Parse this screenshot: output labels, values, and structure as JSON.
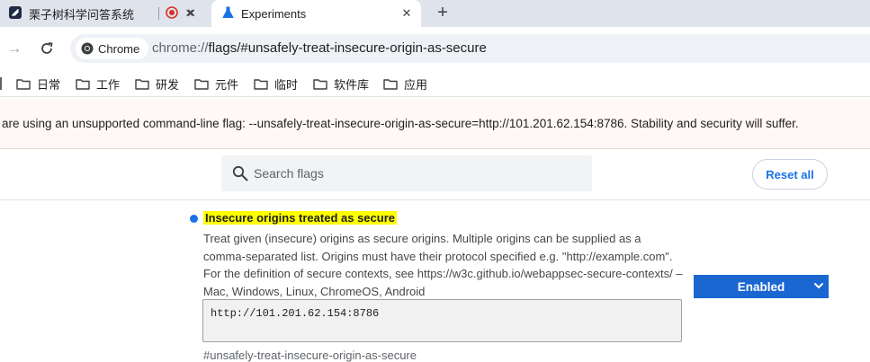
{
  "tabs": [
    {
      "title": "栗子树科学问答系统",
      "icon": "app-logo-icon",
      "active": false
    },
    {
      "title": "",
      "icon": "recording-icon",
      "active": false
    },
    {
      "title": "Experiments",
      "icon": "flask-icon",
      "active": true
    }
  ],
  "toolbar": {
    "chip_label": "Chrome",
    "url_scheme": "chrome://",
    "url_rest": "flags/#unsafely-treat-insecure-origin-as-secure"
  },
  "bookmarks": [
    "日常",
    "工作",
    "研发",
    "元件",
    "临时",
    "软件库",
    "应用"
  ],
  "warning": {
    "text": "are using an unsupported command-line flag: --unsafely-treat-insecure-origin-as-secure=http://101.201.62.154:8786. Stability and security will suffer."
  },
  "search": {
    "placeholder": "Search flags",
    "value": ""
  },
  "reset_label": "Reset all",
  "flag": {
    "title": "Insecure origins treated as secure",
    "description": "Treat given (insecure) origins as secure origins. Multiple origins can be supplied as a comma-separated list. Origins must have their protocol specified e.g. \"http://example.com\". For the definition of secure contexts, see https://w3c.github.io/webappsec-secure-contexts/ – Mac, Windows, Linux, ChromeOS, Android",
    "textarea_value": "http://101.201.62.154:8786",
    "select_value": "Enabled",
    "id": "#unsafely-treat-insecure-origin-as-secure"
  },
  "colors": {
    "accent": "#1a73e8",
    "highlight": "#ffff00",
    "select_bg": "#1a67d2"
  }
}
